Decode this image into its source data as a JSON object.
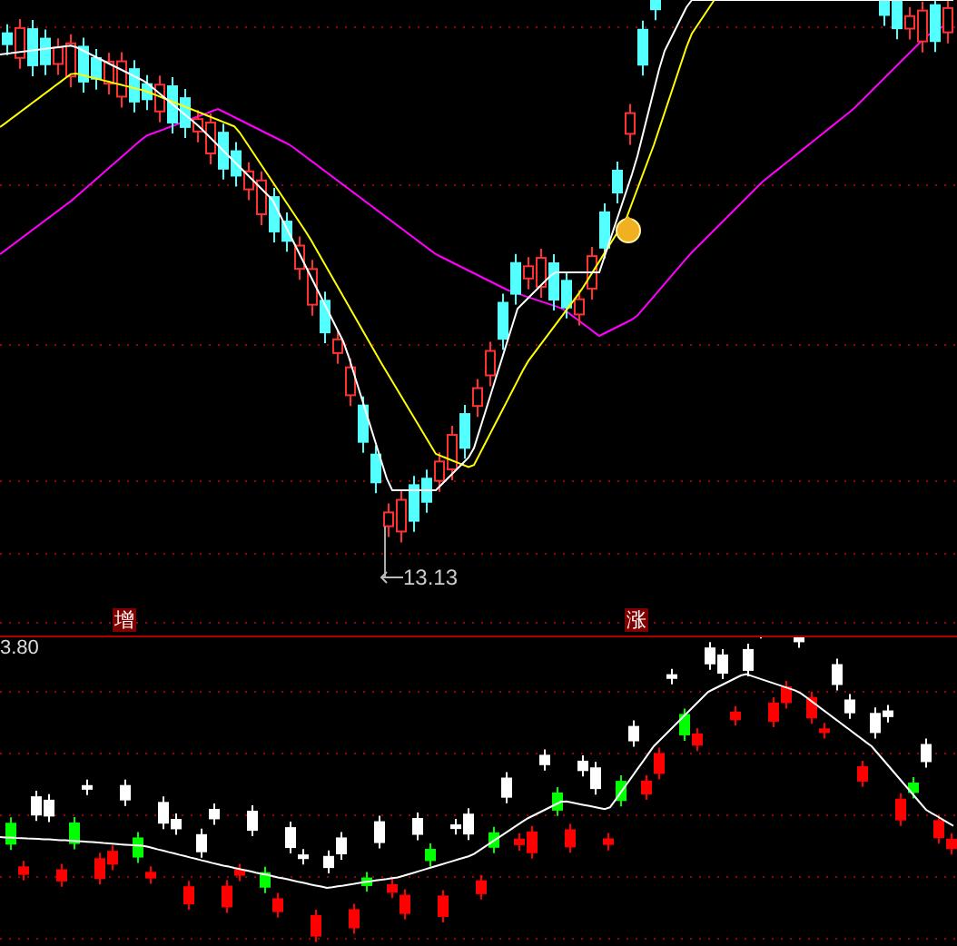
{
  "upper_panel": {
    "low_price_label": "13.13",
    "markers": [
      {
        "text": "增"
      },
      {
        "text": "涨"
      }
    ]
  },
  "lower_panel": {
    "scale_label": "3.80"
  }
}
